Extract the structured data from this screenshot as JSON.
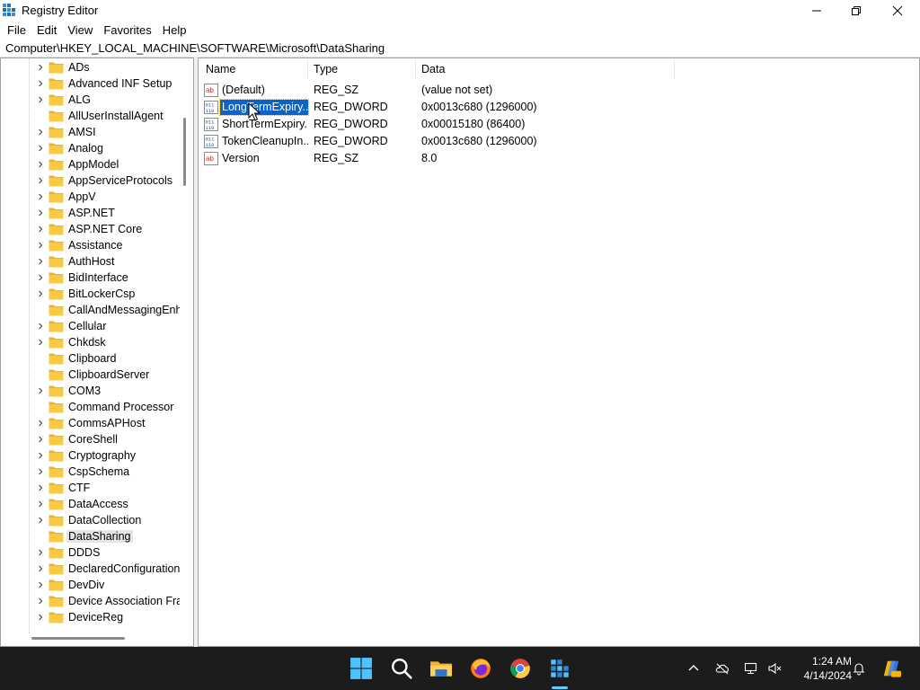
{
  "window": {
    "title": "Registry Editor",
    "minimize_icon": "minimize-icon",
    "restore_icon": "restore-icon",
    "close_icon": "close-icon"
  },
  "menu": [
    "File",
    "Edit",
    "View",
    "Favorites",
    "Help"
  ],
  "address": "Computer\\HKEY_LOCAL_MACHINE\\SOFTWARE\\Microsoft\\DataSharing",
  "tree": {
    "items": [
      {
        "label": "ADs",
        "expandable": true
      },
      {
        "label": "Advanced INF Setup",
        "expandable": true
      },
      {
        "label": "ALG",
        "expandable": true
      },
      {
        "label": "AllUserInstallAgent",
        "expandable": false
      },
      {
        "label": "AMSI",
        "expandable": true
      },
      {
        "label": "Analog",
        "expandable": true
      },
      {
        "label": "AppModel",
        "expandable": true
      },
      {
        "label": "AppServiceProtocols",
        "expandable": true
      },
      {
        "label": "AppV",
        "expandable": true
      },
      {
        "label": "ASP.NET",
        "expandable": true
      },
      {
        "label": "ASP.NET Core",
        "expandable": true
      },
      {
        "label": "Assistance",
        "expandable": true
      },
      {
        "label": "AuthHost",
        "expandable": true
      },
      {
        "label": "BidInterface",
        "expandable": true
      },
      {
        "label": "BitLockerCsp",
        "expandable": true
      },
      {
        "label": "CallAndMessagingEnha",
        "expandable": false
      },
      {
        "label": "Cellular",
        "expandable": true
      },
      {
        "label": "Chkdsk",
        "expandable": true
      },
      {
        "label": "Clipboard",
        "expandable": false
      },
      {
        "label": "ClipboardServer",
        "expandable": false
      },
      {
        "label": "COM3",
        "expandable": true
      },
      {
        "label": "Command Processor",
        "expandable": false
      },
      {
        "label": "CommsAPHost",
        "expandable": true
      },
      {
        "label": "CoreShell",
        "expandable": true
      },
      {
        "label": "Cryptography",
        "expandable": true
      },
      {
        "label": "CspSchema",
        "expandable": true
      },
      {
        "label": "CTF",
        "expandable": true
      },
      {
        "label": "DataAccess",
        "expandable": true
      },
      {
        "label": "DataCollection",
        "expandable": true
      },
      {
        "label": "DataSharing",
        "expandable": false,
        "selected": true
      },
      {
        "label": "DDDS",
        "expandable": true
      },
      {
        "label": "DeclaredConfiguration",
        "expandable": true
      },
      {
        "label": "DevDiv",
        "expandable": true
      },
      {
        "label": "Device Association Frar",
        "expandable": true
      },
      {
        "label": "DeviceReg",
        "expandable": true
      }
    ]
  },
  "list": {
    "columns": {
      "name": "Name",
      "type": "Type",
      "data": "Data"
    },
    "rows": [
      {
        "name": "(Default)",
        "type": "REG_SZ",
        "data": "(value not set)",
        "icon": "string-value-icon"
      },
      {
        "name": "LongTermExpiry...",
        "type": "REG_DWORD",
        "data": "0x0013c680 (1296000)",
        "icon": "dword-value-icon",
        "selected": true
      },
      {
        "name": "ShortTermExpiry...",
        "type": "REG_DWORD",
        "data": "0x00015180 (86400)",
        "icon": "dword-value-icon"
      },
      {
        "name": "TokenCleanupIn...",
        "type": "REG_DWORD",
        "data": "0x0013c680 (1296000)",
        "icon": "dword-value-icon"
      },
      {
        "name": "Version",
        "type": "REG_SZ",
        "data": "8.0",
        "icon": "string-value-icon"
      }
    ]
  },
  "taskbar": {
    "apps": [
      "windows-start-icon",
      "search-icon",
      "file-explorer-icon",
      "firefox-icon",
      "chrome-icon",
      "registry-editor-icon"
    ],
    "tray": [
      "chevron-up-icon",
      "onedrive-icon",
      "network-icon",
      "volume-icon",
      "notification-icon",
      "copilot-icon"
    ],
    "time": "1:24 AM",
    "date": "4/14/2024"
  },
  "colors": {
    "selection": "#0a63c9",
    "taskbar": "#1c1c1c",
    "folder": "#f8c943"
  }
}
